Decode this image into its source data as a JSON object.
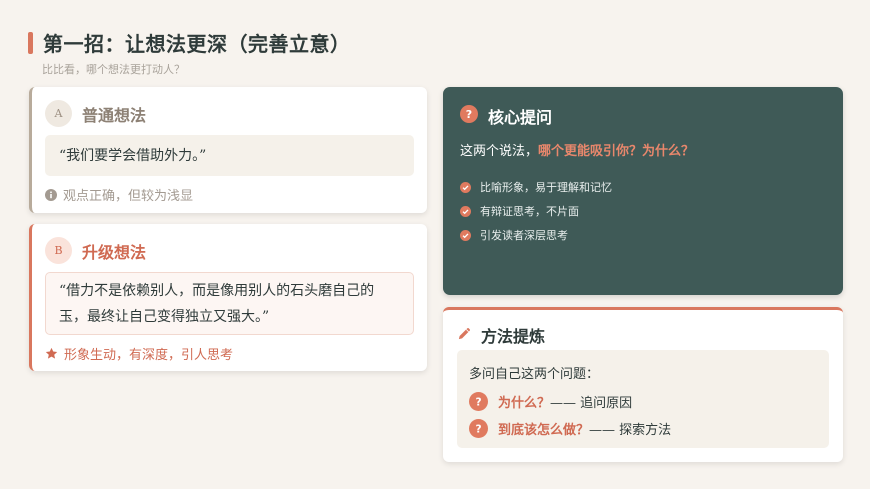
{
  "header": {
    "title": "第一招：让想法更深（完善立意）",
    "subtitle": "比比看，哪个想法更打动人？"
  },
  "card_a": {
    "badge": "A",
    "title": "普通想法",
    "quote": "“我们要学会借助外力。”",
    "note": "观点正确，但较为浅显",
    "note_icon": "info-icon"
  },
  "card_b": {
    "badge": "B",
    "title": "升级想法",
    "quote": "“借力不是依赖别人，而是像用别人的石头磨自己的玉，最终让自己变得独立又强大。”",
    "note": "形象生动，有深度，引人思考",
    "note_icon": "star-icon"
  },
  "core": {
    "title": "核心提问",
    "question_prefix": "这两个说法，",
    "question_highlight": "哪个更能吸引你？为什么？",
    "items": [
      {
        "label": "比喻形象，易于理解和记忆"
      },
      {
        "label": "有辩证思考，不片面"
      },
      {
        "label": "引发读者深层思考"
      }
    ]
  },
  "method": {
    "title": "方法提炼",
    "intro": "多问自己这两个问题：",
    "rows": [
      {
        "highlight": "为什么？",
        "text": "—— 追问原因"
      },
      {
        "highlight": "到底该怎么做？",
        "text": "—— 探索方法"
      }
    ]
  },
  "colors": {
    "accent": "#d9775e",
    "dark_panel": "#3f5a57",
    "background": "#f7f3ee",
    "muted": "#b8ab9b"
  }
}
